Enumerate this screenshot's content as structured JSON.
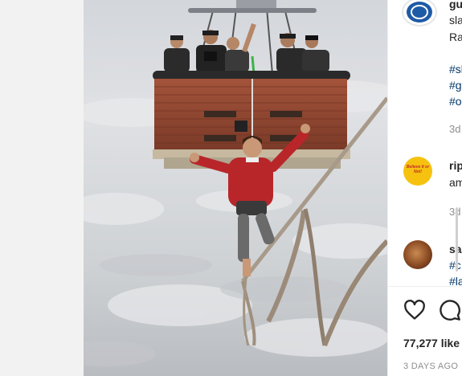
{
  "post": {
    "caption": {
      "username": "gu",
      "line1": "sla",
      "line2": "Ra",
      "tags": [
        "#sl",
        "#g",
        "#o"
      ],
      "time": "3d"
    },
    "comments": [
      {
        "username": "rip",
        "text": "am",
        "time": "3d",
        "avatar_text": "Believe It or Not!"
      },
      {
        "username": "sai",
        "tags": [
          "#c",
          "#la"
        ]
      }
    ],
    "actions": {
      "like_icon": "heart-icon",
      "comment_icon": "comment-icon"
    },
    "likes": "77,277 like",
    "date": "3 DAYS AGO"
  },
  "colors": {
    "link": "#00376b",
    "muted": "#8e8e8e",
    "sky": "#d8dbe0",
    "basket": "#9b4a34",
    "shirt": "#b8262a"
  }
}
